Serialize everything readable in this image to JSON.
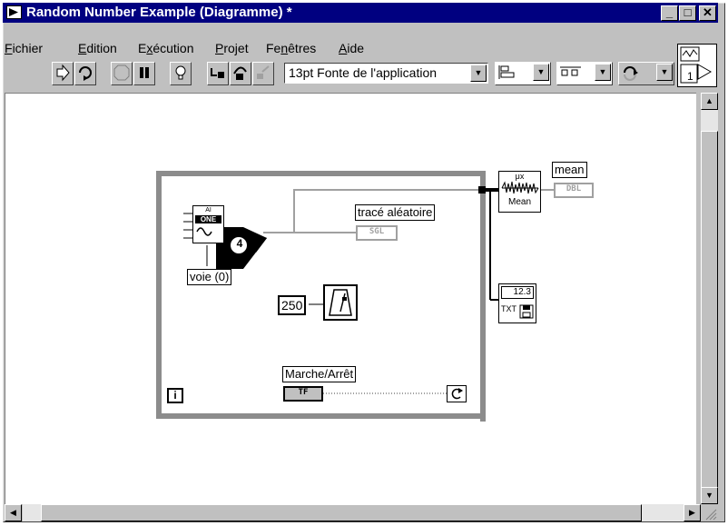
{
  "window": {
    "title": "Random Number Example (Diagramme) *",
    "buttons": {
      "minimize": "_",
      "maximize": "□",
      "close": "✕"
    }
  },
  "menu": [
    {
      "label": "Fichier",
      "u": "F",
      "rest": "ichier"
    },
    {
      "label": "Edition",
      "u": "E",
      "rest": "dition"
    },
    {
      "label": "Exécution",
      "pre": "E",
      "u": "x",
      "rest": "écution"
    },
    {
      "label": "Projet",
      "u": "P",
      "rest": "rojet"
    },
    {
      "label": "Fenêtres",
      "pre": "Fe",
      "u": "n",
      "rest": "êtres"
    },
    {
      "label": "Aide",
      "u": "A",
      "rest": "ide"
    }
  ],
  "toolbar": {
    "font_select": "13pt Fonte de l'application",
    "connector_count": "1"
  },
  "diagram": {
    "daq_header": "AI",
    "daq_one": "ONE",
    "voie_label": "voie (0)",
    "callout_number": "4",
    "trace_label": "tracé aléatoire",
    "trace_type": "SGL",
    "constant_250": "250",
    "marche_label": "Marche/Arrêt",
    "marche_type": "TF",
    "mean_label": "mean",
    "mean_type": "DBL",
    "mean_vi_text": "Mean",
    "mean_vi_mu": "μx",
    "file_vi_num": "12.3",
    "file_vi_txt": "TXT",
    "loop_iter": "i"
  }
}
